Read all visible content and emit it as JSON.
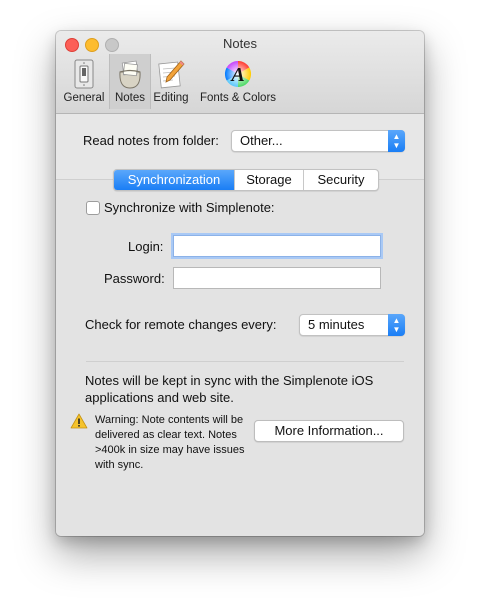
{
  "window": {
    "title": "Notes"
  },
  "toolbar": {
    "items": [
      {
        "label": "General",
        "icon": "light-switch-icon"
      },
      {
        "label": "Notes",
        "icon": "notes-bag-icon",
        "selected": true
      },
      {
        "label": "Editing",
        "icon": "notepad-pencil-icon"
      },
      {
        "label": "Fonts & Colors",
        "icon": "color-wheel-font-icon"
      }
    ]
  },
  "folder": {
    "label": "Read notes from folder:",
    "value": "Other..."
  },
  "tabs": [
    {
      "label": "Synchronization",
      "active": true
    },
    {
      "label": "Storage"
    },
    {
      "label": "Security"
    }
  ],
  "sync": {
    "checkbox_label": "Synchronize with Simplenote:",
    "checked": false,
    "login_label": "Login:",
    "login_value": "",
    "password_label": "Password:",
    "password_value": "",
    "interval_label": "Check for remote changes every:",
    "interval_value": "5 minutes",
    "info_text": "Notes will be kept in sync with the Simplenote iOS applications and web site.",
    "warning_text": "Warning: Note contents will be delivered as clear text. Notes >400k in size may have issues with sync.",
    "more_info_button": "More Information..."
  },
  "colors": {
    "accent": "#1a7ef5",
    "window_bg": "#e7e7e7",
    "warning_icon": "#f5c32c"
  }
}
